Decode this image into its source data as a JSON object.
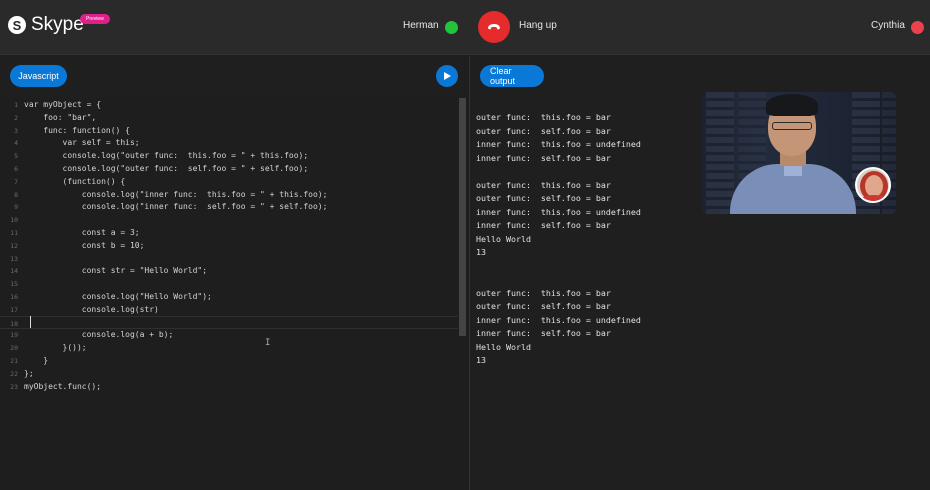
{
  "app": {
    "name": "Skype",
    "badge": "Preview"
  },
  "call": {
    "left_participant": "Herman",
    "left_status_color": "#22c53a",
    "hangup_label": "Hang up",
    "right_participant": "Cynthia",
    "right_status_color": "#e9414e"
  },
  "editor": {
    "language_button": "Javascript",
    "run_icon": "play-icon",
    "lines": [
      "var myObject = {",
      "    foo: \"bar\",",
      "    func: function() {",
      "        var self = this;",
      "        console.log(\"outer func:  this.foo = \" + this.foo);",
      "        console.log(\"outer func:  self.foo = \" + self.foo);",
      "        (function() {",
      "            console.log(\"inner func:  this.foo = \" + this.foo);",
      "            console.log(\"inner func:  self.foo = \" + self.foo);",
      "",
      "            const a = 3;",
      "            const b = 10;",
      "",
      "            const str = \"Hello World\";",
      "",
      "            console.log(\"Hello World\");",
      "            console.log(str)",
      "",
      "            console.log(a + b);",
      "        }());",
      "    }",
      "};",
      "myObject.func();"
    ],
    "line_numbers": [
      "1",
      "2",
      "3",
      "4",
      "5",
      "6",
      "7",
      "8",
      "9",
      "10",
      "11",
      "12",
      "13",
      "14",
      "15",
      "16",
      "17",
      "18",
      "19",
      "20",
      "21",
      "22",
      "23"
    ],
    "active_line": 18
  },
  "output": {
    "clear_button": "Clear output",
    "lines": [
      "outer func:  this.foo = bar",
      "outer func:  self.foo = bar",
      "inner func:  this.foo = undefined",
      "inner func:  self.foo = bar",
      "",
      "outer func:  this.foo = bar",
      "outer func:  self.foo = bar",
      "inner func:  this.foo = undefined",
      "inner func:  self.foo = bar",
      "Hello World",
      "13",
      "",
      "",
      "outer func:  this.foo = bar",
      "outer func:  self.foo = bar",
      "inner func:  this.foo = undefined",
      "inner func:  self.foo = bar",
      "Hello World",
      "13"
    ]
  }
}
